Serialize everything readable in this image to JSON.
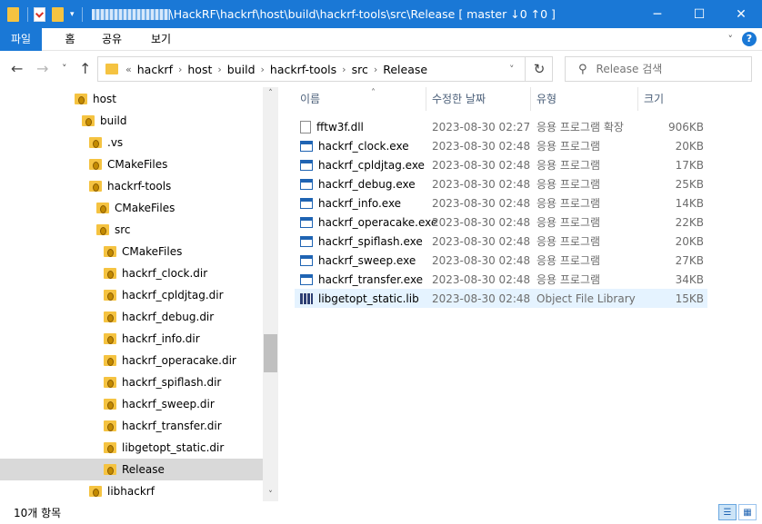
{
  "window": {
    "title": "\\HackRF\\hackrf\\host\\build\\hackrf-tools\\src\\Release [ master ↓0 ↑0 ]",
    "min_glyph": "─",
    "max_glyph": "☐",
    "close_glyph": "✕"
  },
  "ribbon": {
    "tabs": [
      "파일",
      "홈",
      "공유",
      "보기"
    ],
    "collapse_glyph": "˅",
    "help_glyph": "?"
  },
  "nav": {
    "back_glyph": "←",
    "forward_glyph": "→",
    "recent_glyph": "˅",
    "up_glyph": "↑"
  },
  "address": {
    "overflow": "«",
    "crumbs": [
      "hackrf",
      "host",
      "build",
      "hackrf-tools",
      "src",
      "Release"
    ],
    "sep_glyph": "›",
    "dropdown_glyph": "˅",
    "refresh_glyph": "↻"
  },
  "search": {
    "placeholder": "Release 검색",
    "icon_glyph": "⚲"
  },
  "tree": [
    {
      "label": "host",
      "indent": 0
    },
    {
      "label": "build",
      "indent": 1
    },
    {
      "label": ".vs",
      "indent": 2
    },
    {
      "label": "CMakeFiles",
      "indent": 2
    },
    {
      "label": "hackrf-tools",
      "indent": 2
    },
    {
      "label": "CMakeFiles",
      "indent": 3
    },
    {
      "label": "src",
      "indent": 3
    },
    {
      "label": "CMakeFiles",
      "indent": 4
    },
    {
      "label": "hackrf_clock.dir",
      "indent": 4
    },
    {
      "label": "hackrf_cpldjtag.dir",
      "indent": 4
    },
    {
      "label": "hackrf_debug.dir",
      "indent": 4
    },
    {
      "label": "hackrf_info.dir",
      "indent": 4
    },
    {
      "label": "hackrf_operacake.dir",
      "indent": 4
    },
    {
      "label": "hackrf_spiflash.dir",
      "indent": 4
    },
    {
      "label": "hackrf_sweep.dir",
      "indent": 4
    },
    {
      "label": "hackrf_transfer.dir",
      "indent": 4
    },
    {
      "label": "libgetopt_static.dir",
      "indent": 4
    },
    {
      "label": "Release",
      "indent": 4,
      "selected": true
    },
    {
      "label": "libhackrf",
      "indent": 2
    }
  ],
  "scroll": {
    "up_glyph": "˄",
    "down_glyph": "˅"
  },
  "columns": {
    "name": "이름",
    "date": "수정한 날짜",
    "type": "유형",
    "size": "크기",
    "sort_glyph": "˄"
  },
  "files": [
    {
      "name": "fftw3f.dll",
      "date": "2023-08-30 02:27",
      "type": "응용 프로그램 확장",
      "size": "906KB",
      "kind": "dll"
    },
    {
      "name": "hackrf_clock.exe",
      "date": "2023-08-30 02:48",
      "type": "응용 프로그램",
      "size": "20KB",
      "kind": "exe"
    },
    {
      "name": "hackrf_cpldjtag.exe",
      "date": "2023-08-30 02:48",
      "type": "응용 프로그램",
      "size": "17KB",
      "kind": "exe"
    },
    {
      "name": "hackrf_debug.exe",
      "date": "2023-08-30 02:48",
      "type": "응용 프로그램",
      "size": "25KB",
      "kind": "exe"
    },
    {
      "name": "hackrf_info.exe",
      "date": "2023-08-30 02:48",
      "type": "응용 프로그램",
      "size": "14KB",
      "kind": "exe"
    },
    {
      "name": "hackrf_operacake.exe",
      "date": "2023-08-30 02:48",
      "type": "응용 프로그램",
      "size": "22KB",
      "kind": "exe"
    },
    {
      "name": "hackrf_spiflash.exe",
      "date": "2023-08-30 02:48",
      "type": "응용 프로그램",
      "size": "20KB",
      "kind": "exe"
    },
    {
      "name": "hackrf_sweep.exe",
      "date": "2023-08-30 02:48",
      "type": "응용 프로그램",
      "size": "27KB",
      "kind": "exe"
    },
    {
      "name": "hackrf_transfer.exe",
      "date": "2023-08-30 02:48",
      "type": "응용 프로그램",
      "size": "34KB",
      "kind": "exe"
    },
    {
      "name": "libgetopt_static.lib",
      "date": "2023-08-30 02:48",
      "type": "Object File Library",
      "size": "15KB",
      "kind": "lib",
      "highlighted": true
    }
  ],
  "status": {
    "item_count": "10개 항목",
    "details_glyph": "☰",
    "tiles_glyph": "▦"
  },
  "colors": {
    "accent": "#1a78d6",
    "folder": "#f5c341",
    "selected": "#d9d9d9",
    "hover": "#e5f3ff"
  }
}
